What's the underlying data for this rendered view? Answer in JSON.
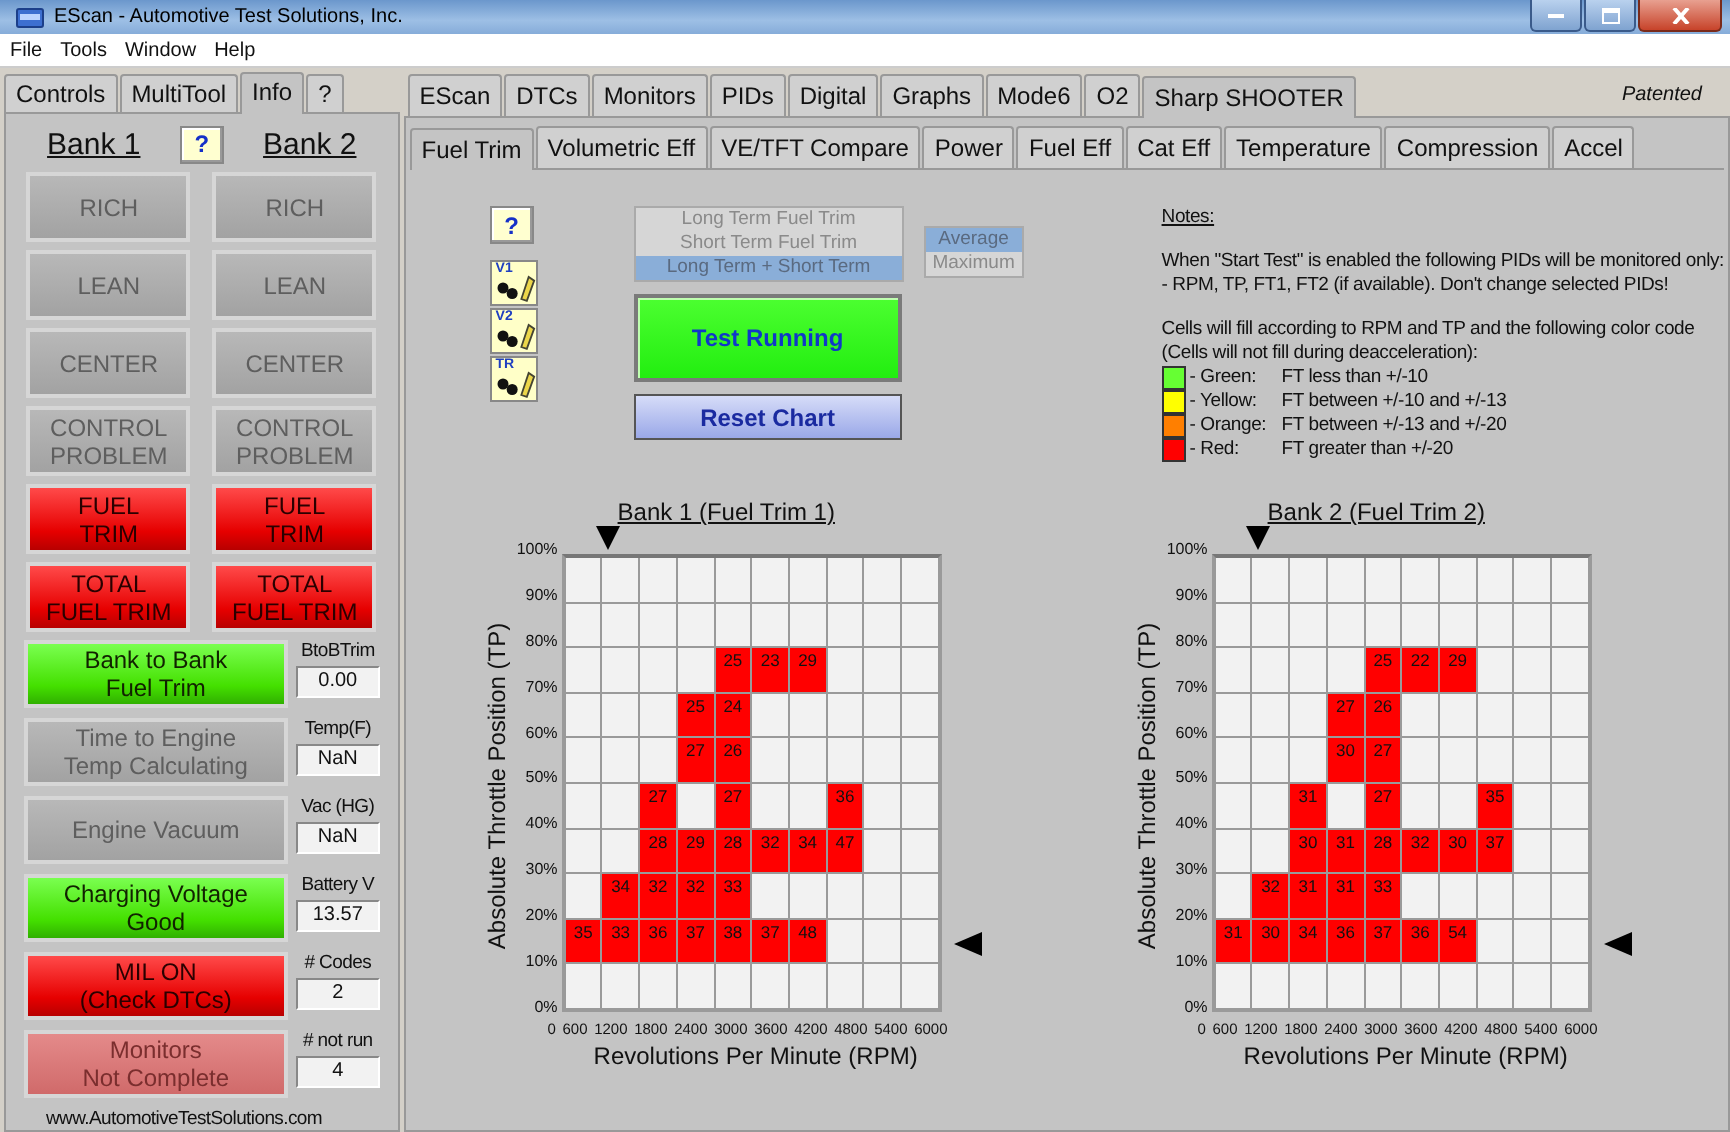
{
  "window": {
    "title": "EScan - Automotive Test Solutions, Inc."
  },
  "menu": [
    "File",
    "Tools",
    "Window",
    "Help"
  ],
  "left_tabs": [
    {
      "label": "Controls",
      "selected": false
    },
    {
      "label": "MultiTool",
      "selected": false
    },
    {
      "label": "Info",
      "selected": true
    },
    {
      "label": "?",
      "selected": false
    }
  ],
  "bank_header": {
    "bank1": "Bank 1",
    "help": "?",
    "bank2": "Bank 2"
  },
  "bank_lamps": [
    {
      "bank1": {
        "label": "RICH",
        "kind": "off"
      },
      "bank2": {
        "label": "RICH",
        "kind": "off"
      }
    },
    {
      "bank1": {
        "label": "LEAN",
        "kind": "off"
      },
      "bank2": {
        "label": "LEAN",
        "kind": "off"
      }
    },
    {
      "bank1": {
        "label": "CENTER",
        "kind": "off"
      },
      "bank2": {
        "label": "CENTER",
        "kind": "off"
      }
    },
    {
      "bank1": {
        "label": "CONTROL\nPROBLEM",
        "kind": "off"
      },
      "bank2": {
        "label": "CONTROL\nPROBLEM",
        "kind": "off"
      }
    },
    {
      "bank1": {
        "label": "FUEL\nTRIM",
        "kind": "red"
      },
      "bank2": {
        "label": "FUEL\nTRIM",
        "kind": "red"
      }
    },
    {
      "bank1": {
        "label": "TOTAL\nFUEL TRIM",
        "kind": "red"
      },
      "bank2": {
        "label": "TOTAL\nFUEL TRIM",
        "kind": "red"
      }
    }
  ],
  "status_lamps": [
    {
      "label": "Bank to Bank\nFuel Trim",
      "kind": "green",
      "reading_label": "BtoBTrim",
      "reading": "0.00"
    },
    {
      "label": "Time to Engine\nTemp Calculating",
      "kind": "off",
      "reading_label": "Temp(F)",
      "reading": "NaN"
    },
    {
      "label": "Engine Vacuum",
      "kind": "off",
      "reading_label": "Vac (HG)",
      "reading": "NaN"
    },
    {
      "label": "Charging Voltage\nGood",
      "kind": "green",
      "reading_label": "Battery V",
      "reading": "13.57"
    },
    {
      "label": "MIL ON\n(Check DTCs)",
      "kind": "red",
      "reading_label": "# Codes",
      "reading": "2"
    },
    {
      "label": "Monitors\nNot Complete",
      "kind": "dim",
      "reading_label": "# not run",
      "reading": "4"
    }
  ],
  "footer": "www.AutomotiveTestSolutions.com",
  "main_tabs": [
    {
      "label": "EScan",
      "selected": false
    },
    {
      "label": "DTCs",
      "selected": false
    },
    {
      "label": "Monitors",
      "selected": false
    },
    {
      "label": "PIDs",
      "selected": false
    },
    {
      "label": "Digital",
      "selected": false
    },
    {
      "label": "Graphs",
      "selected": false
    },
    {
      "label": "Mode6",
      "selected": false
    },
    {
      "label": "O2",
      "selected": false
    },
    {
      "label": "Sharp SHOOTER",
      "selected": true
    }
  ],
  "patented": "Patented",
  "sub_tabs": [
    {
      "label": "Fuel Trim",
      "selected": true
    },
    {
      "label": "Volumetric Eff",
      "selected": false
    },
    {
      "label": "VE/TFT Compare",
      "selected": false
    },
    {
      "label": "Power",
      "selected": false
    },
    {
      "label": "Fuel Eff",
      "selected": false
    },
    {
      "label": "Cat Eff",
      "selected": false
    },
    {
      "label": "Temperature",
      "selected": false
    },
    {
      "label": "Compression",
      "selected": false
    },
    {
      "label": "Accel",
      "selected": false
    }
  ],
  "fuel_trim": {
    "help": "?",
    "tool_icons": [
      {
        "label": "V1"
      },
      {
        "label": "V2"
      },
      {
        "label": "TR"
      }
    ],
    "trim_source": [
      {
        "label": "Long Term Fuel Trim",
        "selected": false
      },
      {
        "label": "Short Term Fuel Trim",
        "selected": false
      },
      {
        "label": "Long Term + Short Term",
        "selected": true
      }
    ],
    "mode": [
      {
        "label": "Average",
        "selected": true
      },
      {
        "label": "Maximum",
        "selected": false
      }
    ],
    "test_button": "Test Running",
    "reset_button": "Reset Chart",
    "notes": {
      "heading": "Notes:",
      "paragraphs": [
        [
          "When \"Start Test\" is enabled the following PIDs will be monitored only:",
          "- RPM, TP, FT1, FT2 (if available).  Don't change selected PIDs!"
        ],
        [
          "Cells will fill according to RPM and TP and the following color code",
          "(Cells will not fill during deacceleration):"
        ]
      ],
      "legend": [
        {
          "color": "#66ff33",
          "name": "- Green:",
          "text": "FT less than +/-10"
        },
        {
          "color": "#ffff00",
          "name": "- Yellow:",
          "text": "FT between +/-10 and +/-13"
        },
        {
          "color": "#ff7f00",
          "name": "- Orange:",
          "text": "FT between +/-13 and +/-20"
        },
        {
          "color": "#ff0000",
          "name": "- Red:",
          "text": "FT greater than +/-20"
        }
      ]
    },
    "charts": [
      {
        "title": "Bank 1 (Fuel Trim 1)",
        "ylabel": "Absolute Throttle Position (TP)",
        "xlabel": "Revolutions Per Minute (RPM)",
        "yticks": [
          "100%",
          "90%",
          "80%",
          "70%",
          "60%",
          "50%",
          "40%",
          "30%",
          "20%",
          "10%",
          "0%"
        ],
        "xticks": [
          "0",
          "600",
          "1200",
          "1800",
          "2400",
          "3000",
          "3600",
          "4200",
          "4800",
          "5400",
          "6000"
        ],
        "rows": [
          [
            {
              "filled": false
            },
            {
              "filled": false
            },
            {
              "filled": false
            },
            {
              "filled": false
            },
            {
              "filled": false
            },
            {
              "filled": false
            },
            {
              "filled": false
            },
            {
              "filled": false
            },
            {
              "filled": false
            },
            {
              "filled": false
            }
          ],
          [
            {
              "filled": false
            },
            {
              "filled": false
            },
            {
              "filled": false
            },
            {
              "filled": false
            },
            {
              "filled": false
            },
            {
              "filled": false
            },
            {
              "filled": false
            },
            {
              "filled": false
            },
            {
              "filled": false
            },
            {
              "filled": false
            }
          ],
          [
            {
              "filled": false
            },
            {
              "filled": false
            },
            {
              "filled": false
            },
            {
              "filled": false
            },
            {
              "filled": true,
              "value": "25",
              "color": "#ff0000"
            },
            {
              "filled": true,
              "value": "23",
              "color": "#ff0000"
            },
            {
              "filled": true,
              "value": "29",
              "color": "#ff0000"
            },
            {
              "filled": false
            },
            {
              "filled": false
            },
            {
              "filled": false
            }
          ],
          [
            {
              "filled": false
            },
            {
              "filled": false
            },
            {
              "filled": false
            },
            {
              "filled": true,
              "value": "25",
              "color": "#ff0000"
            },
            {
              "filled": true,
              "value": "24",
              "color": "#ff0000"
            },
            {
              "filled": false
            },
            {
              "filled": false
            },
            {
              "filled": false
            },
            {
              "filled": false
            },
            {
              "filled": false
            }
          ],
          [
            {
              "filled": false
            },
            {
              "filled": false
            },
            {
              "filled": false
            },
            {
              "filled": true,
              "value": "27",
              "color": "#ff0000"
            },
            {
              "filled": true,
              "value": "26",
              "color": "#ff0000"
            },
            {
              "filled": false
            },
            {
              "filled": false
            },
            {
              "filled": false
            },
            {
              "filled": false
            },
            {
              "filled": false
            }
          ],
          [
            {
              "filled": false
            },
            {
              "filled": false
            },
            {
              "filled": true,
              "value": "27",
              "color": "#ff0000"
            },
            {
              "filled": false
            },
            {
              "filled": true,
              "value": "27",
              "color": "#ff0000"
            },
            {
              "filled": false
            },
            {
              "filled": false
            },
            {
              "filled": true,
              "value": "36",
              "color": "#ff0000"
            },
            {
              "filled": false
            },
            {
              "filled": false
            }
          ],
          [
            {
              "filled": false
            },
            {
              "filled": false
            },
            {
              "filled": true,
              "value": "28",
              "color": "#ff0000"
            },
            {
              "filled": true,
              "value": "29",
              "color": "#ff0000"
            },
            {
              "filled": true,
              "value": "28",
              "color": "#ff0000"
            },
            {
              "filled": true,
              "value": "32",
              "color": "#ff0000"
            },
            {
              "filled": true,
              "value": "34",
              "color": "#ff0000"
            },
            {
              "filled": true,
              "value": "47",
              "color": "#ff0000"
            },
            {
              "filled": false
            },
            {
              "filled": false
            }
          ],
          [
            {
              "filled": false
            },
            {
              "filled": true,
              "value": "34",
              "color": "#ff0000"
            },
            {
              "filled": true,
              "value": "32",
              "color": "#ff0000"
            },
            {
              "filled": true,
              "value": "32",
              "color": "#ff0000"
            },
            {
              "filled": true,
              "value": "33",
              "color": "#ff0000"
            },
            {
              "filled": false
            },
            {
              "filled": false
            },
            {
              "filled": false
            },
            {
              "filled": false
            },
            {
              "filled": false
            }
          ],
          [
            {
              "filled": true,
              "value": "35",
              "color": "#ff0000"
            },
            {
              "filled": true,
              "value": "33",
              "color": "#ff0000"
            },
            {
              "filled": true,
              "value": "36",
              "color": "#ff0000"
            },
            {
              "filled": true,
              "value": "37",
              "color": "#ff0000"
            },
            {
              "filled": true,
              "value": "38",
              "color": "#ff0000"
            },
            {
              "filled": true,
              "value": "37",
              "color": "#ff0000"
            },
            {
              "filled": true,
              "value": "48",
              "color": "#ff0000"
            },
            {
              "filled": false
            },
            {
              "filled": false
            },
            {
              "filled": false
            }
          ],
          [
            {
              "filled": false
            },
            {
              "filled": false
            },
            {
              "filled": false
            },
            {
              "filled": false
            },
            {
              "filled": false
            },
            {
              "filled": false
            },
            {
              "filled": false
            },
            {
              "filled": false
            },
            {
              "filled": false
            },
            {
              "filled": false
            }
          ]
        ]
      },
      {
        "title": "Bank 2 (Fuel Trim 2)",
        "ylabel": "Absolute Throttle Position (TP)",
        "xlabel": "Revolutions Per Minute (RPM)",
        "yticks": [
          "100%",
          "90%",
          "80%",
          "70%",
          "60%",
          "50%",
          "40%",
          "30%",
          "20%",
          "10%",
          "0%"
        ],
        "xticks": [
          "0",
          "600",
          "1200",
          "1800",
          "2400",
          "3000",
          "3600",
          "4200",
          "4800",
          "5400",
          "6000"
        ],
        "rows": [
          [
            {
              "filled": false
            },
            {
              "filled": false
            },
            {
              "filled": false
            },
            {
              "filled": false
            },
            {
              "filled": false
            },
            {
              "filled": false
            },
            {
              "filled": false
            },
            {
              "filled": false
            },
            {
              "filled": false
            },
            {
              "filled": false
            }
          ],
          [
            {
              "filled": false
            },
            {
              "filled": false
            },
            {
              "filled": false
            },
            {
              "filled": false
            },
            {
              "filled": false
            },
            {
              "filled": false
            },
            {
              "filled": false
            },
            {
              "filled": false
            },
            {
              "filled": false
            },
            {
              "filled": false
            }
          ],
          [
            {
              "filled": false
            },
            {
              "filled": false
            },
            {
              "filled": false
            },
            {
              "filled": false
            },
            {
              "filled": true,
              "value": "25",
              "color": "#ff0000"
            },
            {
              "filled": true,
              "value": "22",
              "color": "#ff0000"
            },
            {
              "filled": true,
              "value": "29",
              "color": "#ff0000"
            },
            {
              "filled": false
            },
            {
              "filled": false
            },
            {
              "filled": false
            }
          ],
          [
            {
              "filled": false
            },
            {
              "filled": false
            },
            {
              "filled": false
            },
            {
              "filled": true,
              "value": "27",
              "color": "#ff0000"
            },
            {
              "filled": true,
              "value": "26",
              "color": "#ff0000"
            },
            {
              "filled": false
            },
            {
              "filled": false
            },
            {
              "filled": false
            },
            {
              "filled": false
            },
            {
              "filled": false
            }
          ],
          [
            {
              "filled": false
            },
            {
              "filled": false
            },
            {
              "filled": false
            },
            {
              "filled": true,
              "value": "30",
              "color": "#ff0000"
            },
            {
              "filled": true,
              "value": "27",
              "color": "#ff0000"
            },
            {
              "filled": false
            },
            {
              "filled": false
            },
            {
              "filled": false
            },
            {
              "filled": false
            },
            {
              "filled": false
            }
          ],
          [
            {
              "filled": false
            },
            {
              "filled": false
            },
            {
              "filled": true,
              "value": "31",
              "color": "#ff0000"
            },
            {
              "filled": false
            },
            {
              "filled": true,
              "value": "27",
              "color": "#ff0000"
            },
            {
              "filled": false
            },
            {
              "filled": false
            },
            {
              "filled": true,
              "value": "35",
              "color": "#ff0000"
            },
            {
              "filled": false
            },
            {
              "filled": false
            }
          ],
          [
            {
              "filled": false
            },
            {
              "filled": false
            },
            {
              "filled": true,
              "value": "30",
              "color": "#ff0000"
            },
            {
              "filled": true,
              "value": "31",
              "color": "#ff0000"
            },
            {
              "filled": true,
              "value": "28",
              "color": "#ff0000"
            },
            {
              "filled": true,
              "value": "32",
              "color": "#ff0000"
            },
            {
              "filled": true,
              "value": "30",
              "color": "#ff0000"
            },
            {
              "filled": true,
              "value": "37",
              "color": "#ff0000"
            },
            {
              "filled": false
            },
            {
              "filled": false
            }
          ],
          [
            {
              "filled": false
            },
            {
              "filled": true,
              "value": "32",
              "color": "#ff0000"
            },
            {
              "filled": true,
              "value": "31",
              "color": "#ff0000"
            },
            {
              "filled": true,
              "value": "31",
              "color": "#ff0000"
            },
            {
              "filled": true,
              "value": "33",
              "color": "#ff0000"
            },
            {
              "filled": false
            },
            {
              "filled": false
            },
            {
              "filled": false
            },
            {
              "filled": false
            },
            {
              "filled": false
            }
          ],
          [
            {
              "filled": true,
              "value": "31",
              "color": "#ff0000"
            },
            {
              "filled": true,
              "value": "30",
              "color": "#ff0000"
            },
            {
              "filled": true,
              "value": "34",
              "color": "#ff0000"
            },
            {
              "filled": true,
              "value": "36",
              "color": "#ff0000"
            },
            {
              "filled": true,
              "value": "37",
              "color": "#ff0000"
            },
            {
              "filled": true,
              "value": "36",
              "color": "#ff0000"
            },
            {
              "filled": true,
              "value": "54",
              "color": "#ff0000"
            },
            {
              "filled": false
            },
            {
              "filled": false
            },
            {
              "filled": false
            }
          ],
          [
            {
              "filled": false
            },
            {
              "filled": false
            },
            {
              "filled": false
            },
            {
              "filled": false
            },
            {
              "filled": false
            },
            {
              "filled": false
            },
            {
              "filled": false
            },
            {
              "filled": false
            },
            {
              "filled": false
            },
            {
              "filled": false
            }
          ]
        ]
      }
    ]
  }
}
